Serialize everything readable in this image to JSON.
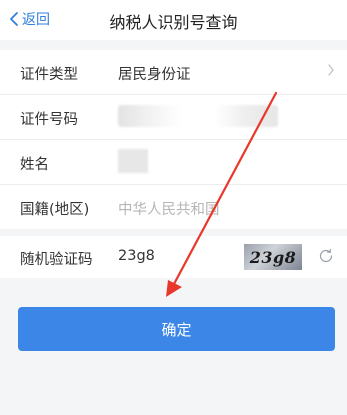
{
  "header": {
    "back_label": "返回",
    "title": "纳税人识别号查询"
  },
  "form": {
    "rows": [
      {
        "label": "证件类型",
        "value": "居民身份证"
      },
      {
        "label": "证件号码",
        "value": ""
      },
      {
        "label": "姓名",
        "value": ""
      },
      {
        "label": "国籍(地区)",
        "value": "中华人民共和国"
      }
    ]
  },
  "captcha": {
    "label": "随机验证码",
    "input_value": "23g8",
    "image_text": "23g8"
  },
  "confirm_label": "确定",
  "colors": {
    "accent": "#3b86e6",
    "annotation": "#e8372b"
  }
}
